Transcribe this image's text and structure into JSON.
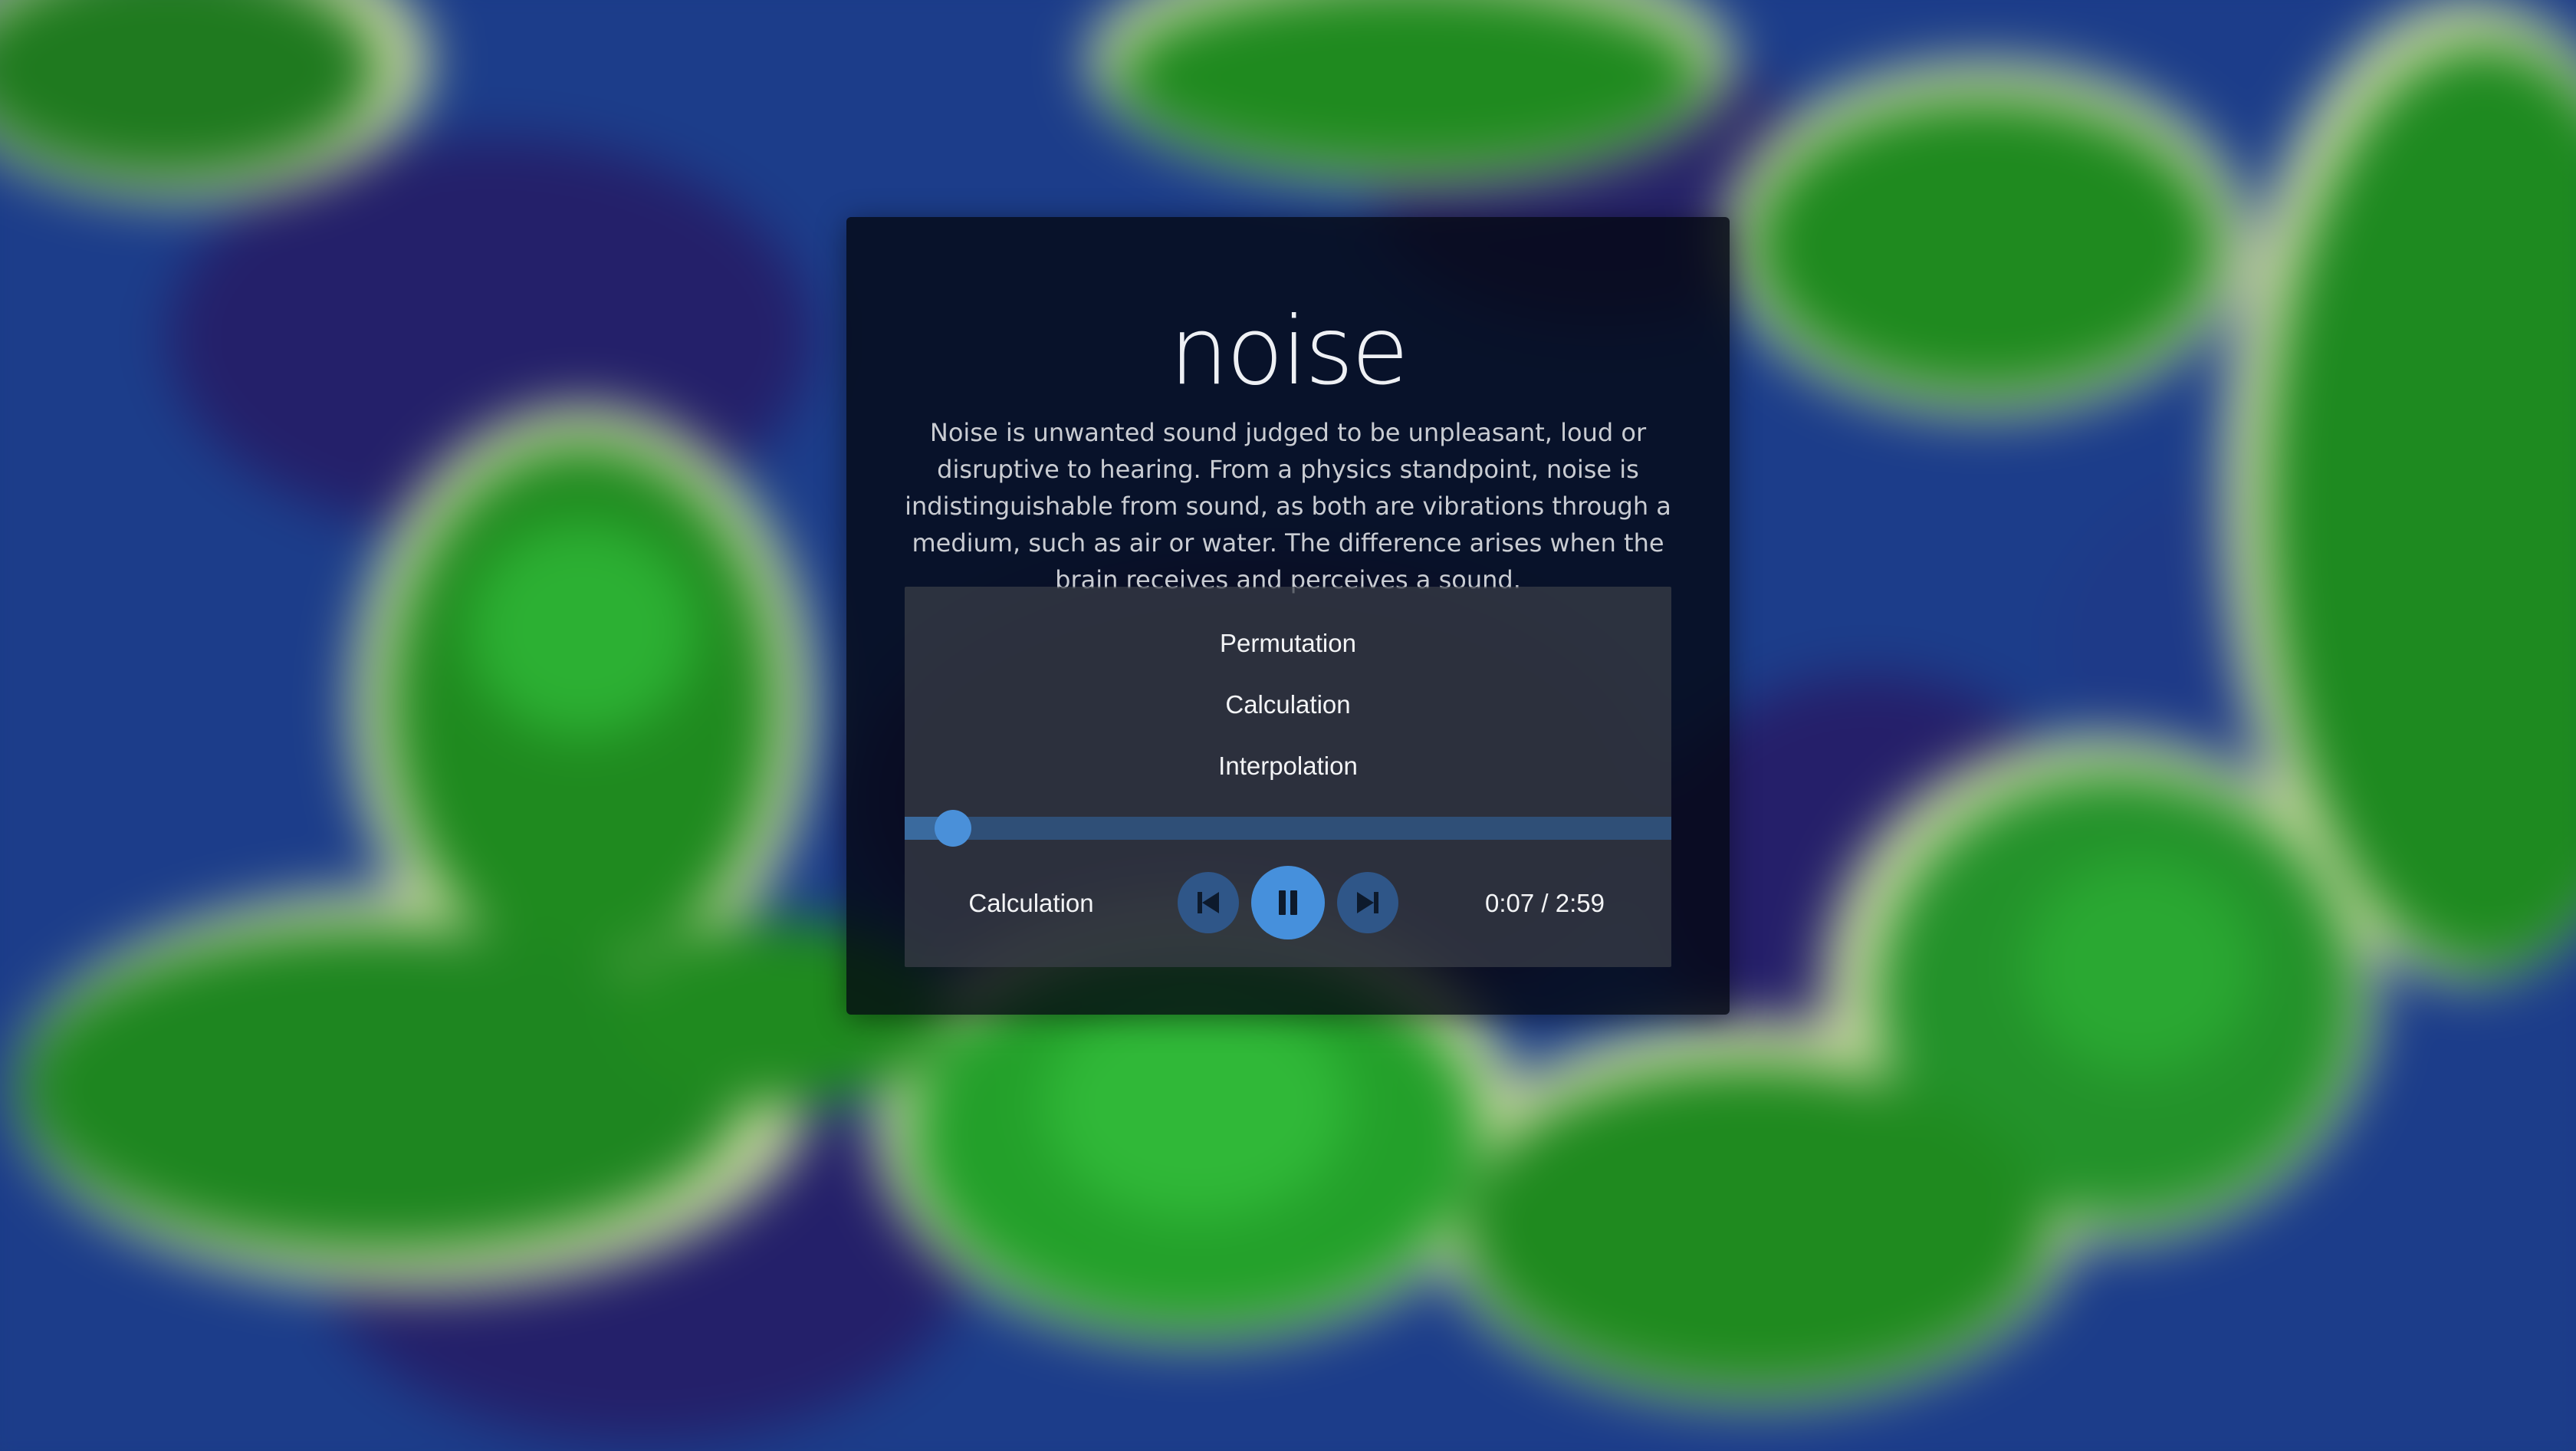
{
  "colors": {
    "accent": "#4690dc",
    "accent_dark": "#2f5688",
    "seek_track": "#2f4f77",
    "card_bg": "rgba(4,8,18,0.80)",
    "player_bg": "rgba(58,62,72,0.72)",
    "bg_ocean": "#1c3d8a",
    "bg_deep": "#24206a",
    "bg_land": "#1f8a1f",
    "bg_sand": "#c8d8a0"
  },
  "card": {
    "title": "noise",
    "description": "Noise is unwanted sound judged to be unpleasant, loud or disruptive to hearing. From a physics standpoint, noise is indistinguishable from sound, as both are vibrations through a medium, such as air or water. The difference arises when the brain receives and perceives a sound."
  },
  "player": {
    "tracks": [
      {
        "label": "Permutation"
      },
      {
        "label": "Calculation"
      },
      {
        "label": "Interpolation"
      }
    ],
    "now_playing": "Calculation",
    "time_display": "0:07 / 2:59",
    "progress_fraction": 0.039,
    "controls": {
      "prev_icon": "skip-previous-icon",
      "play_icon": "pause-icon",
      "next_icon": "skip-next-icon"
    }
  }
}
